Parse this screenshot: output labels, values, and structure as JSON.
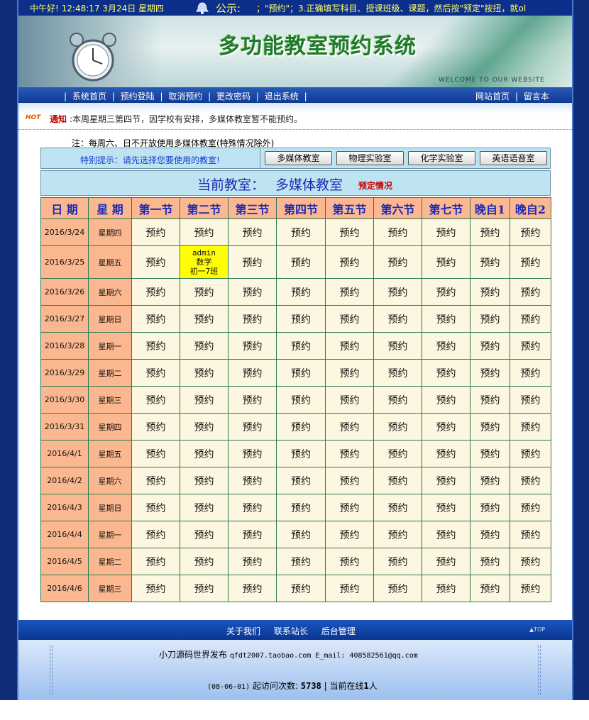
{
  "topbar": {
    "clock": "中午好! 12:48:17 3月24日 星期四",
    "notice_label": "公示:",
    "marquee": "；\"预约\"；3.正确填写科目、授课班级、课题，然后按\"预定\"按扭，就ol"
  },
  "banner": {
    "title": "多功能教室预约系统",
    "welcome": "WELCOME TO OUR WEBSITE"
  },
  "nav": {
    "left": [
      "系统首页",
      "预约登陆",
      "取消预约",
      "更改密码",
      "退出系统"
    ],
    "right": [
      "网站首页",
      "留言本"
    ]
  },
  "notice": {
    "hot": "HOT",
    "title": "通知",
    "text": ":本周星期三第四节，因学校有安排，多媒体教室暂不能预约。"
  },
  "note": "注：每周六、日不开放使用多媒体教室(特殊情况除外)",
  "tip": "特别提示：请先选择您要使用的教室!",
  "rooms": [
    "多媒体教室",
    "物理实验室",
    "化学实验室",
    "英语语音室"
  ],
  "current": {
    "label": "当前教室：",
    "room": "多媒体教室",
    "status_link": "预定情况"
  },
  "schedule": {
    "headers": [
      "日 期",
      "星 期",
      "第一节",
      "第二节",
      "第三节",
      "第四节",
      "第五节",
      "第六节",
      "第七节",
      "晚自1",
      "晚自2"
    ],
    "slot_label": "预约",
    "rows": [
      {
        "date": "2016/3/24",
        "day": "星期四"
      },
      {
        "date": "2016/3/25",
        "day": "星期五",
        "booked": {
          "slot": 1,
          "user": "admin",
          "subject": "数学",
          "class": "初一7班"
        }
      },
      {
        "date": "2016/3/26",
        "day": "星期六"
      },
      {
        "date": "2016/3/27",
        "day": "星期日"
      },
      {
        "date": "2016/3/28",
        "day": "星期一"
      },
      {
        "date": "2016/3/29",
        "day": "星期二"
      },
      {
        "date": "2016/3/30",
        "day": "星期三"
      },
      {
        "date": "2016/3/31",
        "day": "星期四"
      },
      {
        "date": "2016/4/1",
        "day": "星期五"
      },
      {
        "date": "2016/4/2",
        "day": "星期六"
      },
      {
        "date": "2016/4/3",
        "day": "星期日"
      },
      {
        "date": "2016/4/4",
        "day": "星期一"
      },
      {
        "date": "2016/4/5",
        "day": "星期二"
      },
      {
        "date": "2016/4/6",
        "day": "星期三"
      }
    ]
  },
  "footer": {
    "links": [
      "关于我们",
      "联系站长",
      "后台管理"
    ],
    "top": "▲TOP",
    "publisher": "小刀源码世界发布",
    "contact": "qfdt2007.taobao.com E_mail: 408582561@qq.com",
    "since": "(08-06-01)",
    "visits_label": "起访问次数:",
    "visits": "5738",
    "online_prefix": "| 当前在线",
    "online": "1",
    "online_suffix": "人"
  },
  "colors": {
    "frame": "#0f2c78",
    "header_cell": "#fbb890",
    "slot_cell": "#fdf6e0",
    "booked_cell": "#ffff00",
    "title_green": "#1e7a2c"
  }
}
